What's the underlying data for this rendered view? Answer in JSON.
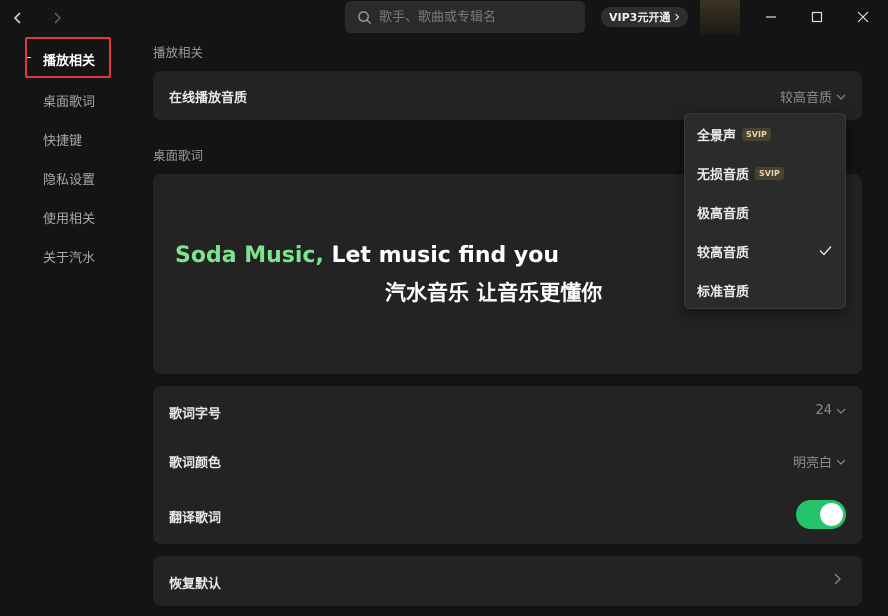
{
  "search": {
    "placeholder": "歌手、歌曲或专辑名"
  },
  "vip": {
    "label": "VIP3元开通"
  },
  "sidebar": {
    "items": [
      {
        "label": "播放相关"
      },
      {
        "label": "桌面歌词"
      },
      {
        "label": "快捷键"
      },
      {
        "label": "隐私设置"
      },
      {
        "label": "使用相关"
      },
      {
        "label": "关于汽水"
      }
    ]
  },
  "main": {
    "playback_section": "播放相关",
    "online_quality_label": "在线播放音质",
    "online_quality_value": "较高音质",
    "desktop_lyrics_section": "桌面歌词",
    "preview": {
      "brand": "Soda Music,",
      "slogan_en": " Let music find you",
      "slogan_zh": "汽水音乐 让音乐更懂你"
    },
    "lyric_size_label": "歌词字号",
    "lyric_size_value": "24",
    "lyric_color_label": "歌词颜色",
    "lyric_color_value": "明亮白",
    "translate_label": "翻译歌词",
    "translate_on": true,
    "reset_label": "恢复默认"
  },
  "dropdown": {
    "options": [
      {
        "label": "全景声",
        "badge": "SVIP"
      },
      {
        "label": "无损音质",
        "badge": "SVIP"
      },
      {
        "label": "极高音质",
        "badge": ""
      },
      {
        "label": "较高音质",
        "badge": "",
        "selected": true
      },
      {
        "label": "标准音质",
        "badge": ""
      }
    ]
  },
  "colors": {
    "accent_green": "#7de38f",
    "toggle_green": "#25c46a",
    "highlight_red": "#e0393d"
  }
}
